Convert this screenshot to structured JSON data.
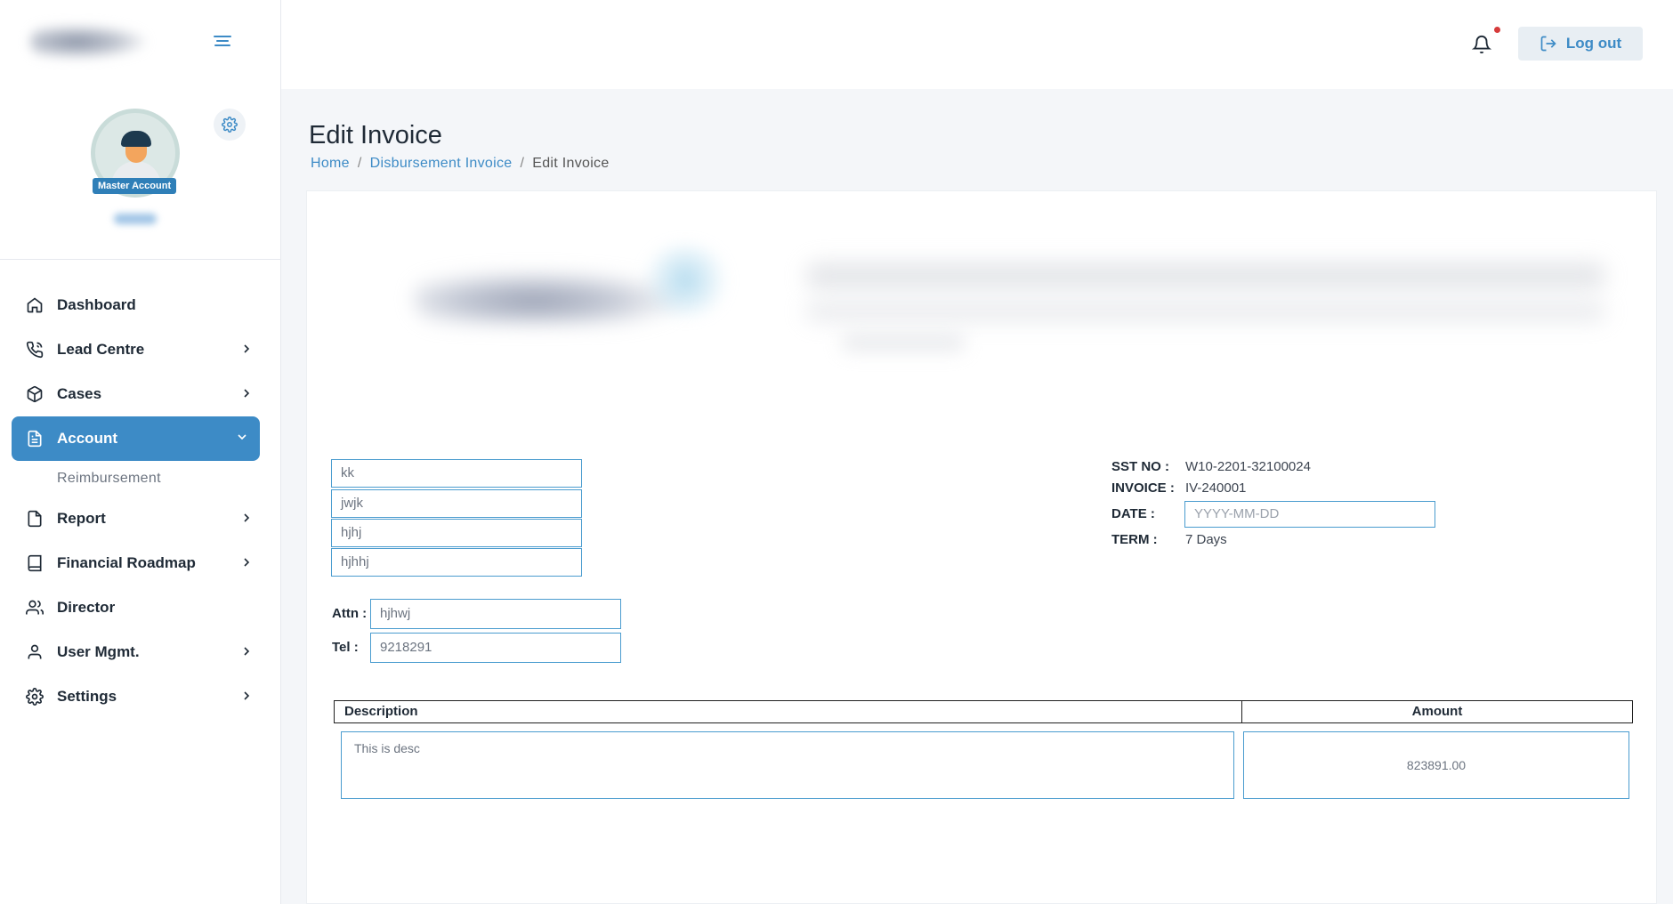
{
  "sidebar": {
    "badge": "Master Account",
    "nav": [
      {
        "label": "Dashboard",
        "icon": "home-icon"
      },
      {
        "label": "Lead Centre",
        "icon": "phone-icon"
      },
      {
        "label": "Cases",
        "icon": "box-icon"
      },
      {
        "label": "Account",
        "icon": "document-icon",
        "active": true
      },
      {
        "label": "Report",
        "icon": "file-icon"
      },
      {
        "label": "Financial Roadmap",
        "icon": "book-icon"
      },
      {
        "label": "Director",
        "icon": "users-icon"
      },
      {
        "label": "User Mgmt.",
        "icon": "user-icon"
      },
      {
        "label": "Settings",
        "icon": "gear-icon"
      }
    ],
    "subitem": "Reimbursement"
  },
  "topbar": {
    "logout_label": "Log out"
  },
  "page": {
    "title": "Edit Invoice",
    "breadcrumb": [
      "Home",
      "Disbursement Invoice",
      "Edit Invoice"
    ]
  },
  "invoice": {
    "address_lines": [
      "kk",
      "jwjk",
      "hjhj",
      "hjhhj"
    ],
    "attn_label": "Attn :",
    "attn_value": "hjhwj",
    "tel_label": "Tel :",
    "tel_value": "9218291",
    "sst_label": "SST NO :",
    "sst_value": "W10-2201-32100024",
    "invoice_label": "INVOICE :",
    "invoice_value": "IV-240001",
    "date_label": "DATE :",
    "date_placeholder": "YYYY-MM-DD",
    "term_label": "TERM :",
    "term_value": "7 Days",
    "table": {
      "headers": [
        "Description",
        "Amount"
      ],
      "description": "This is desc",
      "amount": "823891.00"
    }
  }
}
